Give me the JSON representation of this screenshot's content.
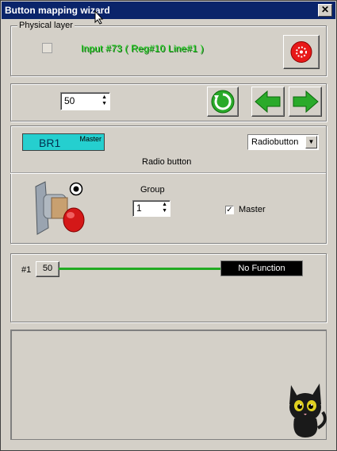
{
  "window": {
    "title": "Button mapping wizard",
    "close_glyph": "✕"
  },
  "physical_layer": {
    "group_label": "Physical layer",
    "input_info": "Input #73  ( Reg#10   Line#1 )",
    "stop_icon": "red-stop-icon"
  },
  "controls": {
    "value": "50",
    "refresh_icon": "green-refresh-icon",
    "back_icon": "green-left-arrow-icon",
    "forward_icon": "green-right-arrow-icon"
  },
  "button_config": {
    "name": "BR1",
    "master_tag": "Master",
    "type_selected": "Radiobutton",
    "type_label": "Radio button",
    "group_label": "Group",
    "group_value": "1",
    "master_checkbox_label": "Master",
    "master_checked": true
  },
  "mapping": {
    "index_label": "#1",
    "value_button": "50",
    "function": "No Function"
  },
  "colors": {
    "title_bar": "#0a246a",
    "br1_fill": "#25cfcf",
    "input_text": "#22d822",
    "mapping_line": "#22aa22"
  }
}
